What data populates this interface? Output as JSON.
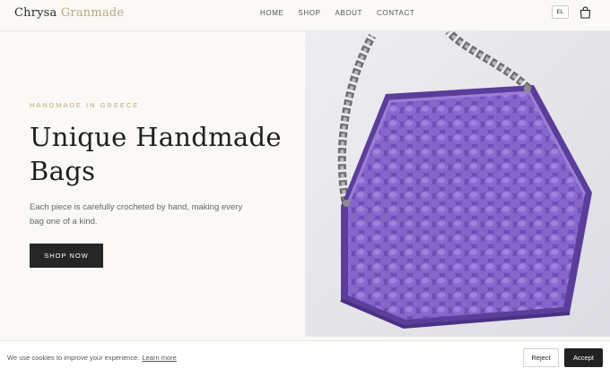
{
  "header": {
    "logo_part1": "Chrysa",
    "logo_part2": "Granmade",
    "nav": [
      "HOME",
      "SHOP",
      "ABOUT",
      "CONTACT"
    ],
    "lang": "EL",
    "cart_icon": "shopping-bag-icon"
  },
  "hero": {
    "eyebrow": "HANDMADE IN GREECE",
    "title_line1": "Unique Handmade",
    "title_line2": "Bags",
    "text": "Each piece is carefully crocheted by hand, making every bag one of a kind.",
    "button": "SHOP NOW",
    "image_alt": "Purple crocheted handbag with silver chain strap"
  },
  "cookie": {
    "text": "We use cookies to improve your experience.",
    "link": "Learn more",
    "reject": "Reject",
    "accept": "Accept"
  },
  "colors": {
    "accent": "#b9a97f",
    "bag": "#7b5bc0",
    "dark": "#262626",
    "background": "#faf9f6"
  }
}
